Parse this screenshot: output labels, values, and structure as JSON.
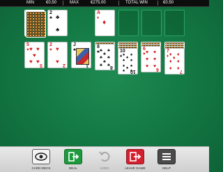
{
  "topbar": {
    "min_label": "MIN",
    "min_value": "€0.50",
    "max_label": "MAX",
    "max_value": "€275.00",
    "total_win_label": "TOTAL WIN",
    "total_win_value": "€0.50"
  },
  "foundation": {
    "ace_rank": "A",
    "ace_suit": "♦"
  },
  "waste": {
    "rank": "2",
    "suit": "♣"
  },
  "tableau": [
    {
      "rank": "5",
      "suit": "♥"
    },
    {
      "rank": "2",
      "suit": "♥"
    },
    {
      "rank": "J",
      "suit": "♣"
    },
    {
      "rank": "8",
      "suit": "♣"
    },
    {
      "rank": "10",
      "suit": "♠"
    },
    {
      "rank": "6",
      "suit": "♥"
    },
    {
      "rank": "7",
      "suit": "♦"
    }
  ],
  "toolbar": {
    "card_deck": "CARD DECK",
    "deal": "DEAL",
    "undo": "UNDO",
    "leave_game": "LEAVE GAME",
    "help": "HELP"
  },
  "colors": {
    "felt": "#147a45",
    "deal": "#1e9a3e",
    "leave": "#d4202e",
    "help": "#4a4a4a"
  }
}
